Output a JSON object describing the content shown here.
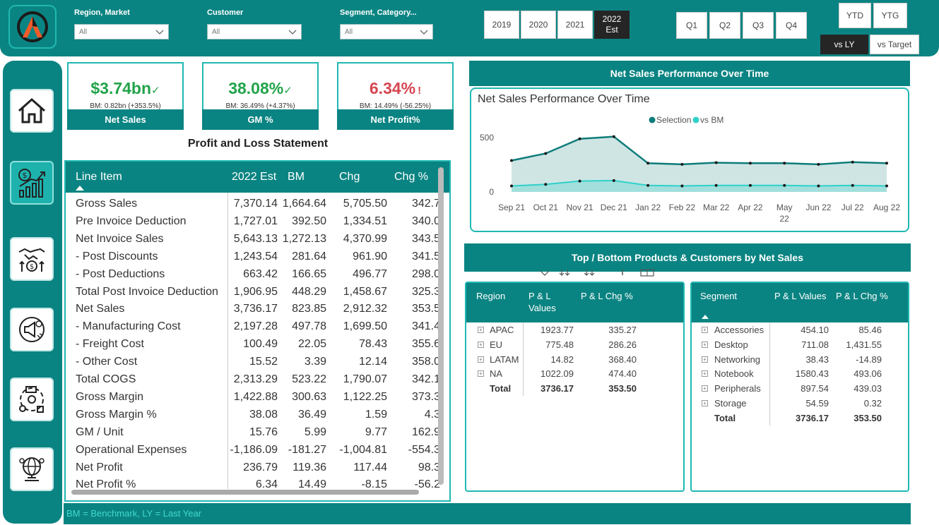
{
  "filters": [
    {
      "label": "Region, Market",
      "value": "All"
    },
    {
      "label": "Customer",
      "value": "All"
    },
    {
      "label": "Segment, Category...",
      "value": "All"
    }
  ],
  "years": [
    "2019",
    "2020",
    "2021",
    "2022"
  ],
  "year_sub": "Est",
  "quarters": [
    "Q1",
    "Q2",
    "Q3",
    "Q4"
  ],
  "period": {
    "ytd": "YTD",
    "ytg": "YTG"
  },
  "compare": {
    "ly": "vs LY",
    "target": "vs Target"
  },
  "kpis": [
    {
      "value": "$3.74bn",
      "mark": "✓",
      "sub": "BM: 0.82bn (+353.5%)",
      "label": "Net Sales",
      "color": "#22a34a"
    },
    {
      "value": "38.08%",
      "mark": "✓",
      "sub": "BM: 36.49% (+4.37%)",
      "label": "GM %",
      "color": "#22a34a"
    },
    {
      "value": "6.34%",
      "mark": "!",
      "sub": "BM: 14.49% (-56.25%)",
      "label": "Net Profit%",
      "color": "#d64550"
    }
  ],
  "pl": {
    "title": "Profit and Loss Statement",
    "headers": [
      "Line Item",
      "2022 Est",
      "BM",
      "Chg",
      "Chg %"
    ],
    "rows": [
      [
        "Gross Sales",
        "7,370.14",
        "1,664.64",
        "5,705.50",
        "342.7"
      ],
      [
        "Pre Invoice Deduction",
        "1,727.01",
        "392.50",
        "1,334.51",
        "340.0"
      ],
      [
        "Net Invoice Sales",
        "5,643.13",
        "1,272.13",
        "4,370.99",
        "343.5"
      ],
      [
        "- Post Discounts",
        "1,243.54",
        "281.64",
        "961.90",
        "341.5"
      ],
      [
        "- Post Deductions",
        "663.42",
        "166.65",
        "496.77",
        "298.0"
      ],
      [
        "Total Post Invoice Deduction",
        "1,906.95",
        "448.29",
        "1,458.67",
        "325.3"
      ],
      [
        "Net Sales",
        "3,736.17",
        "823.85",
        "2,912.32",
        "353.5"
      ],
      [
        "- Manufacturing Cost",
        "2,197.28",
        "497.78",
        "1,699.50",
        "341.4"
      ],
      [
        "- Freight Cost",
        "100.49",
        "22.05",
        "78.43",
        "355.6"
      ],
      [
        "- Other Cost",
        "15.52",
        "3.39",
        "12.14",
        "358.0"
      ],
      [
        "Total COGS",
        "2,313.29",
        "523.22",
        "1,790.07",
        "342.1"
      ],
      [
        "Gross Margin",
        "1,422.88",
        "300.63",
        "1,122.25",
        "373.3"
      ],
      [
        "Gross Margin %",
        "38.08",
        "36.49",
        "1.59",
        "4.3"
      ],
      [
        "GM / Unit",
        "15.76",
        "5.99",
        "9.77",
        "162.9"
      ],
      [
        "Operational Expenses",
        "-1,186.09",
        "-181.27",
        "-1,004.81",
        "-554.3"
      ],
      [
        "Net Profit",
        "236.79",
        "119.36",
        "117.44",
        "98.3"
      ],
      [
        "Net Profit %",
        "6.34",
        "14.49",
        "-8.15",
        "-56.2"
      ]
    ]
  },
  "chart_section": "Net Sales Performance Over Time",
  "chart_data": {
    "type": "area",
    "title": "Net Sales Performance Over Time",
    "categories": [
      "Sep 21",
      "Oct 21",
      "Nov 21",
      "Dec 21",
      "Jan 22",
      "Feb 22",
      "Mar 22",
      "Apr 22",
      "May 22",
      "Jun 22",
      "Jul 22",
      "Aug 22"
    ],
    "series": [
      {
        "name": "Selection",
        "color": "#0d7c7a",
        "values": [
          290,
          355,
          490,
          510,
          265,
          255,
          270,
          265,
          265,
          255,
          275,
          265
        ]
      },
      {
        "name": "vs BM",
        "color": "#2ed1ca",
        "values": [
          55,
          70,
          100,
          105,
          60,
          55,
          60,
          60,
          60,
          55,
          60,
          55
        ]
      }
    ],
    "yticks": [
      "500",
      "0"
    ],
    "ylim": [
      0,
      560
    ],
    "legend": "top-center",
    "grid": false
  },
  "top_section": "Top / Bottom Products & Customers by Net Sales",
  "region_matrix": {
    "headers": [
      "Region",
      "P & L Values",
      "P & L Chg %"
    ],
    "rows": [
      [
        "APAC",
        "1923.77",
        "335.27"
      ],
      [
        "EU",
        "775.48",
        "286.26"
      ],
      [
        "LATAM",
        "14.82",
        "368.40"
      ],
      [
        "NA",
        "1022.09",
        "474.40"
      ]
    ],
    "total": [
      "Total",
      "3736.17",
      "353.50"
    ]
  },
  "segment_matrix": {
    "headers": [
      "Segment",
      "P & L Values",
      "P & L Chg %"
    ],
    "rows": [
      [
        "Accessories",
        "454.10",
        "85.46"
      ],
      [
        "Desktop",
        "711.08",
        "1,431.55"
      ],
      [
        "Networking",
        "38.43",
        "-14.89"
      ],
      [
        "Notebook",
        "1580.43",
        "493.06"
      ],
      [
        "Peripherals",
        "897.54",
        "439.03"
      ],
      [
        "Storage",
        "54.59",
        "0.32"
      ]
    ],
    "total": [
      "Total",
      "3736.17",
      "353.50"
    ]
  },
  "footer": "BM = Benchmark, LY = Last Year"
}
